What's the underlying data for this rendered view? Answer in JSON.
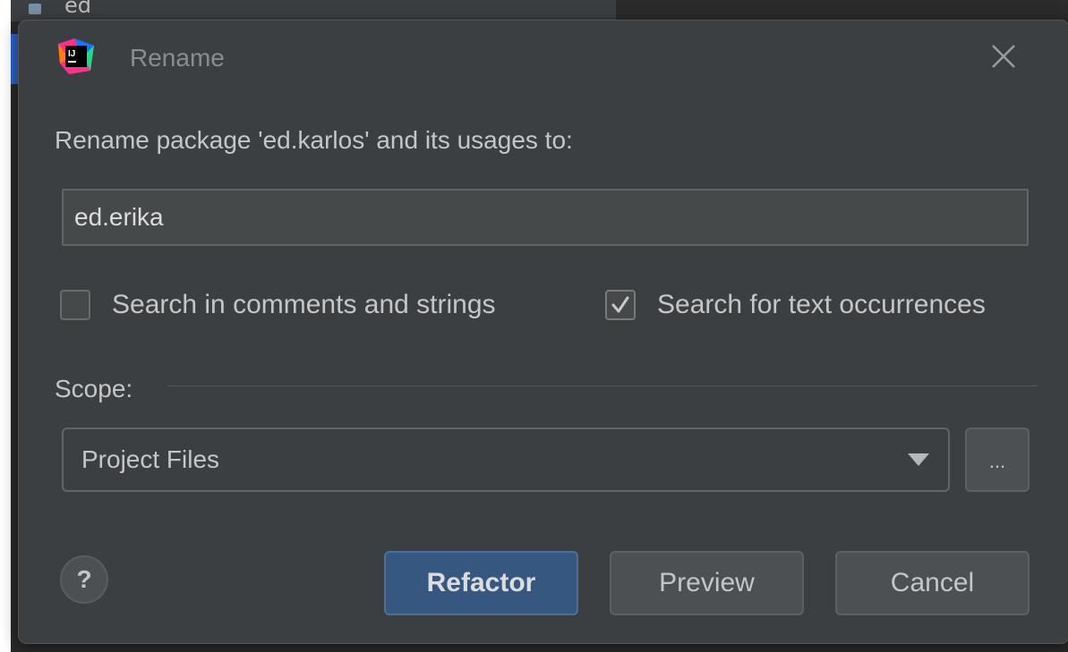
{
  "background": {
    "top_text": "ed"
  },
  "dialog": {
    "title": "Rename",
    "prompt": "Rename package 'ed.karlos' and its usages to:",
    "name_value": "ed.erika",
    "checkboxes": [
      {
        "label": "Search in comments and strings",
        "checked": false
      },
      {
        "label": "Search for text occurrences",
        "checked": true
      }
    ],
    "scope_label": "Scope:",
    "scope_value": "Project Files",
    "ellipsis_label": "...",
    "help_label": "?",
    "buttons": {
      "refactor": "Refactor",
      "preview": "Preview",
      "cancel": "Cancel"
    }
  },
  "icons": {
    "app": "intellij-idea-icon",
    "close": "close-icon",
    "checkmark": "checkmark-icon",
    "dropdown": "triangle-down-icon"
  },
  "colors": {
    "dialog_bg": "#3c3f41",
    "primary_button": "#365880",
    "text": "#c4c6c8"
  }
}
